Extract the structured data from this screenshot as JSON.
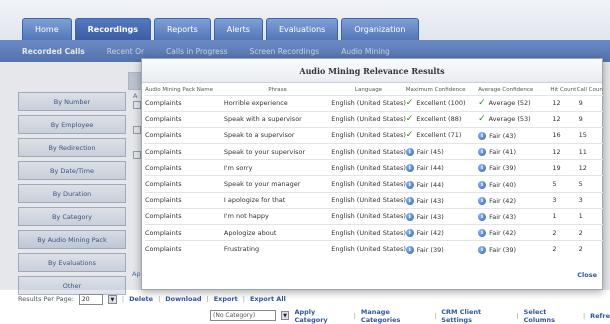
{
  "tabs": [
    {
      "label": "Home"
    },
    {
      "label": "Recordings"
    },
    {
      "label": "Reports"
    },
    {
      "label": "Alerts"
    },
    {
      "label": "Evaluations"
    },
    {
      "label": "Organization"
    }
  ],
  "subnav": [
    {
      "label": "Recorded Calls"
    },
    {
      "label": "Recent Or"
    },
    {
      "label": "Calls in Progress"
    },
    {
      "label": "Screen Recordings"
    },
    {
      "label": "Audio Mining"
    }
  ],
  "sidebar": {
    "items": [
      {
        "label": "By Number"
      },
      {
        "label": "By Employee"
      },
      {
        "label": "By Redirection"
      },
      {
        "label": "By Date/Time"
      },
      {
        "label": "By Duration"
      },
      {
        "label": "By Category"
      },
      {
        "label": "By Audio Mining Pack"
      },
      {
        "label": "By Evaluations"
      },
      {
        "label": "Other"
      }
    ]
  },
  "background": {
    "ghost_ap": "Ap",
    "ghost_a": "A"
  },
  "bottom": {
    "results_per_page_label": "Results Per Page:",
    "results_per_page_value": "20",
    "delete": "Delete",
    "download": "Download",
    "export": "Export",
    "export_all": "Export All",
    "category_select": "(No Category)",
    "apply_category": "Apply Category",
    "manage_categories": "Manage Categories",
    "crm_client_settings": "CRM Client Settings",
    "select_columns": "Select Columns",
    "refresh": "Refre"
  },
  "dialog": {
    "title": "Audio Mining Relevance Results",
    "columns": [
      "Audio Mining Pack Name",
      "Phrase",
      "Language",
      "Maximum Confidence",
      "Average Confidence",
      "Hit Count",
      "Call Count"
    ],
    "rows": [
      {
        "pack": "Complaints",
        "phrase": "Horrible experience",
        "language": "English (United States)",
        "max_icon": "check-icon",
        "max_conf": "Excellent (100)",
        "avg_icon": "check-icon",
        "avg_conf": "Average (52)",
        "hits": "12",
        "calls": "9"
      },
      {
        "pack": "Complaints",
        "phrase": "Speak with a supervisor",
        "language": "English (United States)",
        "max_icon": "check-icon",
        "max_conf": "Excellent (88)",
        "avg_icon": "check-icon",
        "avg_conf": "Average (53)",
        "hits": "12",
        "calls": "9"
      },
      {
        "pack": "Complaints",
        "phrase": "Speak to a supervisor",
        "language": "English (United States)",
        "max_icon": "check-icon",
        "max_conf": "Excellent (71)",
        "avg_icon": "info-icon",
        "avg_conf": "Fair (43)",
        "hits": "16",
        "calls": "15"
      },
      {
        "pack": "Complaints",
        "phrase": "Speak to your supervisor",
        "language": "English (United States)",
        "max_icon": "info-icon",
        "max_conf": "Fair (45)",
        "avg_icon": "info-icon",
        "avg_conf": "Fair (41)",
        "hits": "12",
        "calls": "11"
      },
      {
        "pack": "Complaints",
        "phrase": "I'm sorry",
        "language": "English (United States)",
        "max_icon": "info-icon",
        "max_conf": "Fair (44)",
        "avg_icon": "info-icon",
        "avg_conf": "Fair (39)",
        "hits": "19",
        "calls": "12"
      },
      {
        "pack": "Complaints",
        "phrase": "Speak to your manager",
        "language": "English (United States)",
        "max_icon": "info-icon",
        "max_conf": "Fair (44)",
        "avg_icon": "info-icon",
        "avg_conf": "Fair (40)",
        "hits": "5",
        "calls": "5"
      },
      {
        "pack": "Complaints",
        "phrase": "I apologize for that",
        "language": "English (United States)",
        "max_icon": "info-icon",
        "max_conf": "Fair (43)",
        "avg_icon": "info-icon",
        "avg_conf": "Fair (42)",
        "hits": "3",
        "calls": "3"
      },
      {
        "pack": "Complaints",
        "phrase": "I'm not happy",
        "language": "English (United States)",
        "max_icon": "info-icon",
        "max_conf": "Fair (43)",
        "avg_icon": "info-icon",
        "avg_conf": "Fair (43)",
        "hits": "1",
        "calls": "1"
      },
      {
        "pack": "Complaints",
        "phrase": "Apologize about",
        "language": "English (United States)",
        "max_icon": "info-icon",
        "max_conf": "Fair (42)",
        "avg_icon": "info-icon",
        "avg_conf": "Fair (42)",
        "hits": "2",
        "calls": "2"
      },
      {
        "pack": "Complaints",
        "phrase": "Frustrating",
        "language": "English (United States)",
        "max_icon": "info-icon",
        "max_conf": "Fair (39)",
        "avg_icon": "info-icon",
        "avg_conf": "Fair (39)",
        "hits": "2",
        "calls": "2"
      }
    ],
    "close_label": "Close"
  },
  "colors": {
    "tab_blue": "#5277b9",
    "link_blue": "#2f56a1",
    "check_green": "#2d8a25"
  }
}
